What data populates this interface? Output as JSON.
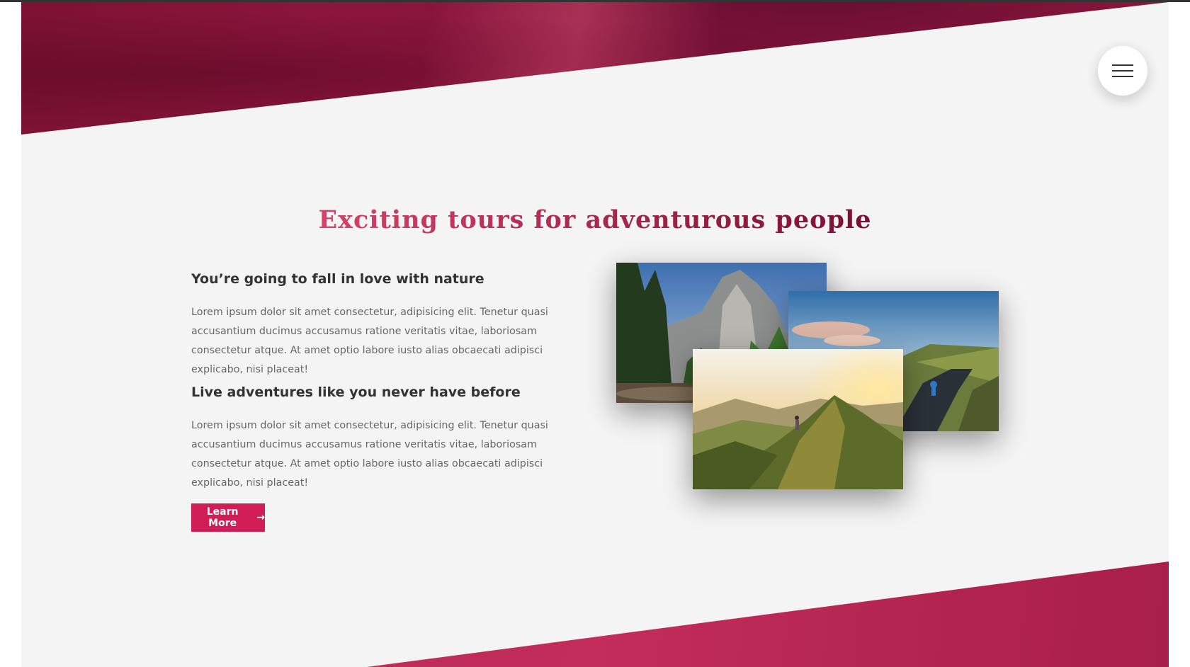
{
  "header": {
    "menu_icon": "hamburger-menu-icon"
  },
  "main": {
    "title": "Exciting tours for adventurous people",
    "features": [
      {
        "heading": "You’re going to fall in love with nature",
        "text": "Lorem ipsum dolor sit amet consectetur, adipisicing elit. Tenetur quasi accusantium ducimus accusamus ratione veritatis vitae, laboriosam consectetur atque. At amet optio labore iusto alias obcaecati adipisci explicabo, nisi placeat!"
      },
      {
        "heading": "Live adventures like you never have before",
        "text": "Lorem ipsum dolor sit amet consectetur, adipisicing elit. Tenetur quasi accusantium ducimus accusamus ratione veritatis vitae, laboriosam consectetur atque. At amet optio labore iusto alias obcaecati adipisci explicabo, nisi placeat!"
      }
    ],
    "cta": {
      "label": "Learn More",
      "arrow": "→"
    }
  },
  "gallery": {
    "photos": [
      "forest-cliffs-photo",
      "cyclist-road-photo",
      "hiker-ridge-photo"
    ]
  },
  "colors": {
    "brand": "#d01d55",
    "brand_dark": "#7d1233",
    "background": "#f4f4f4",
    "heading_text": "#333333",
    "body_text": "#666666"
  }
}
